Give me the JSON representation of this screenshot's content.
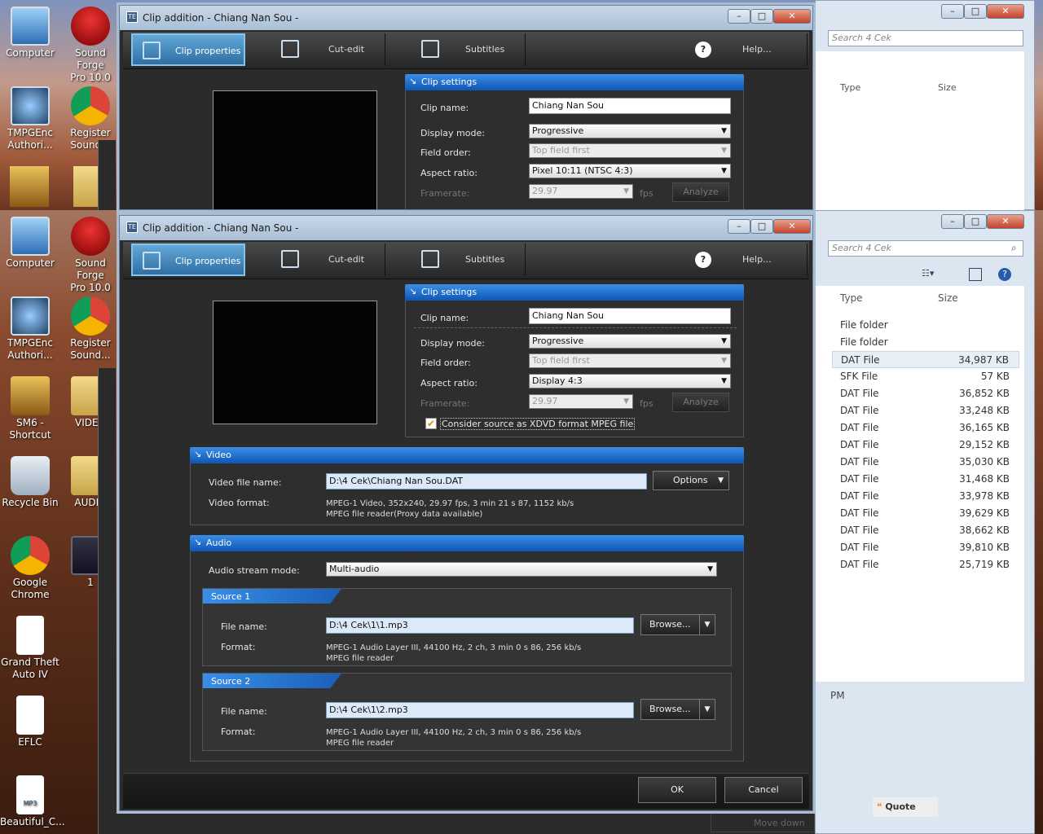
{
  "desktop_icons": [
    {
      "label1": "Computer",
      "label2": ""
    },
    {
      "label1": "Sound Forge",
      "label2": "Pro 10.0"
    },
    {
      "label1": "TMPGEnc",
      "label2": "Authori..."
    },
    {
      "label1": "Register",
      "label2": "Sound..."
    },
    {
      "label1": "SM6 -",
      "label2": "Shortcut"
    },
    {
      "label1": "VIDEO",
      "label2": ""
    },
    {
      "label1": "Recycle Bin",
      "label2": ""
    },
    {
      "label1": "AUDIO",
      "label2": ""
    },
    {
      "label1": "Google",
      "label2": "Chrome"
    },
    {
      "label1": "1",
      "label2": ""
    },
    {
      "label1": "Grand Theft",
      "label2": "Auto IV"
    },
    {
      "label1": "EFLC",
      "label2": ""
    },
    {
      "label1": "Beautiful_C...",
      "label2": ""
    },
    {
      "label1": "MP3",
      "label2": ""
    }
  ],
  "dialog": {
    "title": "Clip addition - Chiang Nan Sou -",
    "tabs": [
      "Clip properties",
      "Cut-edit",
      "Subtitles",
      "Help..."
    ],
    "help_glyph": "?",
    "clip_settings": {
      "header": "Clip settings",
      "clip_name_label": "Clip name:",
      "clip_name": "Chiang Nan Sou",
      "display_mode_label": "Display mode:",
      "display_mode": "Progressive",
      "field_order_label": "Field order:",
      "field_order": "Top field first",
      "aspect_ratio_label": "Aspect ratio:",
      "aspect_ratio_top": "Pixel 10:11 (NTSC 4:3)",
      "aspect_ratio": "Display 4:3",
      "framerate_label": "Framerate:",
      "framerate": "29.97",
      "fps": "fps",
      "analyze": "Analyze",
      "xdvd_label": "Consider source as XDVD format MPEG file"
    },
    "video": {
      "header": "Video",
      "file_name_label": "Video file name:",
      "file_name": "D:\\4 Cek\\Chiang Nan Sou.DAT",
      "options": "Options",
      "format_label": "Video format:",
      "format_line1": "MPEG-1 Video,  352x240,  29.97  fps,  3 min 21 s 87,  1152  kb/s",
      "format_line2": "MPEG file reader(Proxy data available)"
    },
    "audio": {
      "header": "Audio",
      "stream_mode_label": "Audio stream mode:",
      "stream_mode": "Multi-audio",
      "sources": [
        {
          "title": "Source 1",
          "file_name_label": "File name:",
          "file_name": "D:\\4 Cek\\1\\1.mp3",
          "browse": "Browse...",
          "format_label": "Format:",
          "format_line1": "MPEG-1 Audio Layer III,  44100  Hz,  2  ch,  3 min 0 s 86,  256  kb/s",
          "format_line2": "MPEG file reader"
        },
        {
          "title": "Source 2",
          "file_name_label": "File name:",
          "file_name": "D:\\4 Cek\\1\\2.mp3",
          "browse": "Browse...",
          "format_label": "Format:",
          "format_line1": "MPEG-1 Audio Layer III,  44100  Hz,  2  ch,  3 min 0 s 86,  256  kb/s",
          "format_line2": "MPEG file reader"
        }
      ]
    },
    "ok": "OK",
    "cancel": "Cancel"
  },
  "explorer": {
    "search_placeholder": "Search 4 Cek",
    "col_type": "Type",
    "col_size": "Size",
    "rows": [
      {
        "type": "File folder",
        "size": ""
      },
      {
        "type": "File folder",
        "size": ""
      },
      {
        "type": "DAT File",
        "size": "34,987 KB"
      },
      {
        "type": "SFK File",
        "size": "57 KB"
      },
      {
        "type": "DAT File",
        "size": "36,852 KB"
      },
      {
        "type": "DAT File",
        "size": "33,248 KB"
      },
      {
        "type": "DAT File",
        "size": "36,165 KB"
      },
      {
        "type": "DAT File",
        "size": "29,152 KB"
      },
      {
        "type": "DAT File",
        "size": "35,030 KB"
      },
      {
        "type": "DAT File",
        "size": "31,468 KB"
      },
      {
        "type": "DAT File",
        "size": "33,978 KB"
      },
      {
        "type": "DAT File",
        "size": "39,629 KB"
      },
      {
        "type": "DAT File",
        "size": "38,662 KB"
      },
      {
        "type": "DAT File",
        "size": "39,810 KB"
      },
      {
        "type": "DAT File",
        "size": "25,719 KB"
      }
    ],
    "pm": "PM",
    "quote": "Quote",
    "move_down": "Move down"
  },
  "colors": {
    "accent": "#1f6fd0",
    "dialog_bg": "#2b2b2b"
  }
}
